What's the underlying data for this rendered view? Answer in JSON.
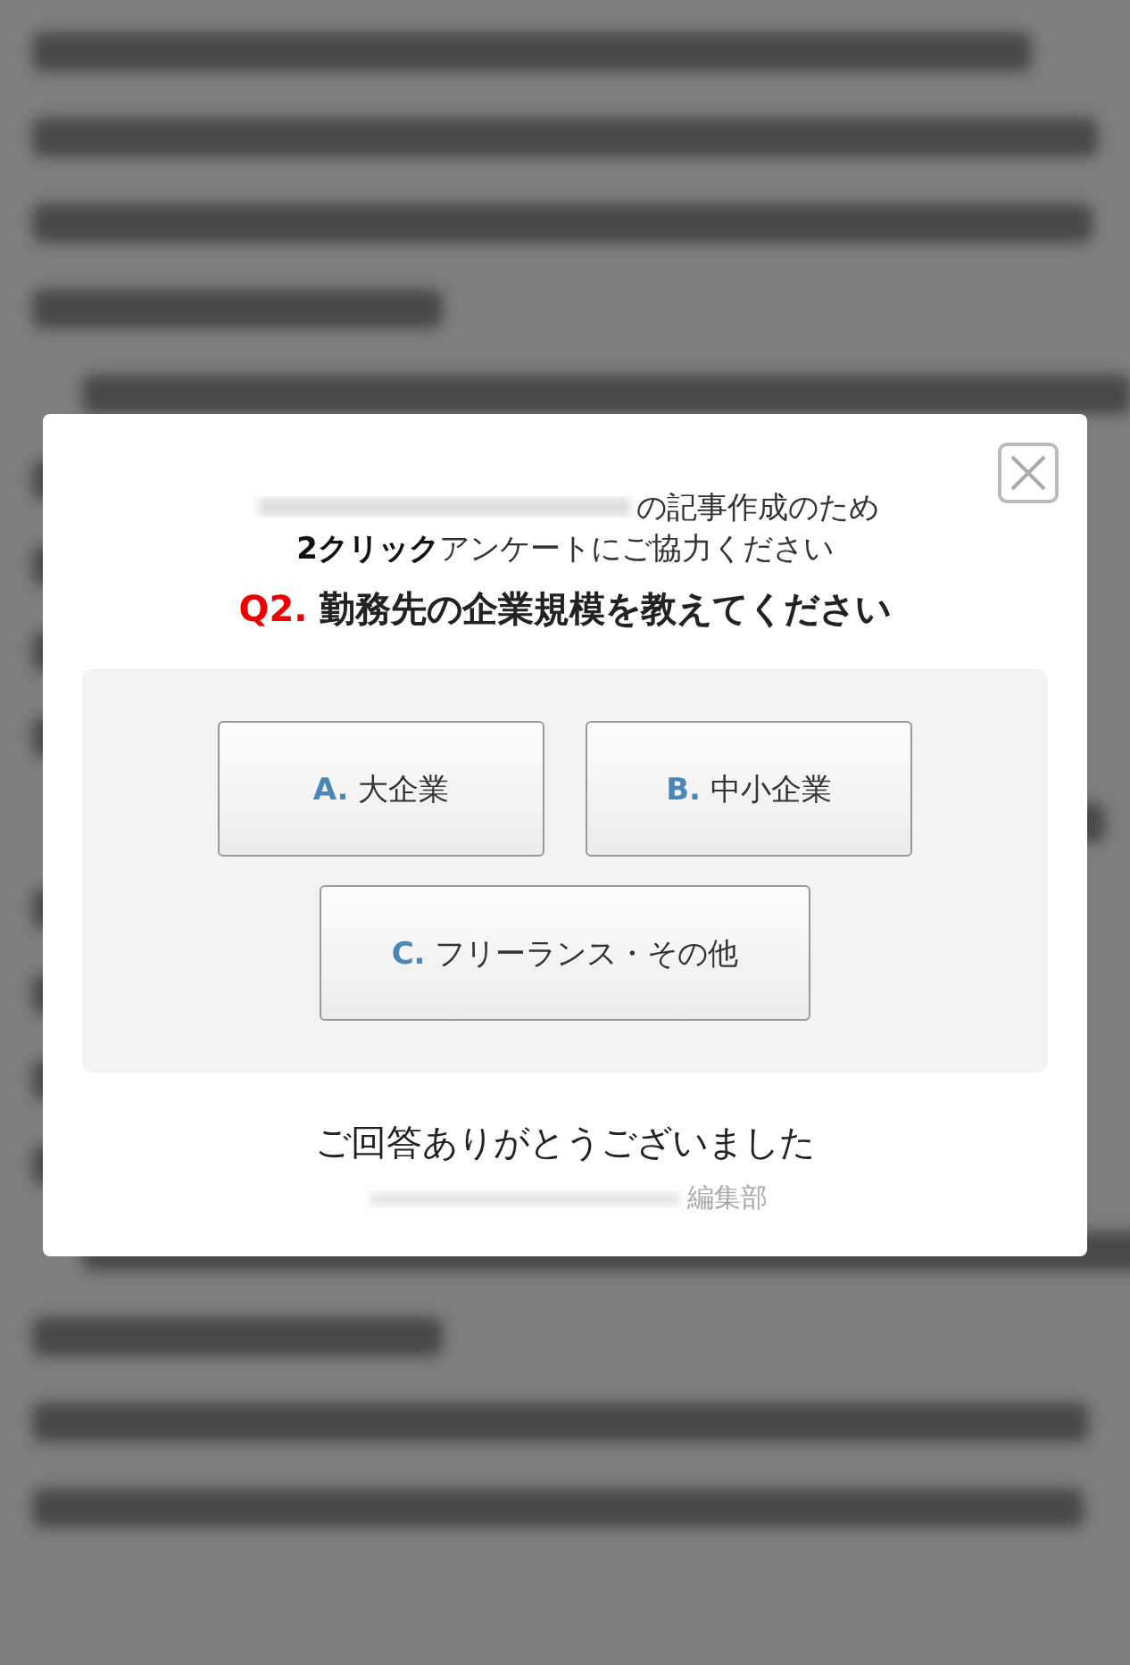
{
  "survey": {
    "intro": "の記事作成のため",
    "request": "**2クリック**アンケートにご協力ください",
    "question": {
      "number": "Q2.",
      "text": "勤務先の企業規模を教えてください"
    },
    "options": [
      {
        "letter": "A.",
        "label": "大企業"
      },
      {
        "letter": "B.",
        "label": "中小企業"
      },
      {
        "letter": "C.",
        "label": "フリーランス・その他"
      }
    ],
    "thanks": "ご回答ありがとうございました",
    "signature": "編集部"
  }
}
